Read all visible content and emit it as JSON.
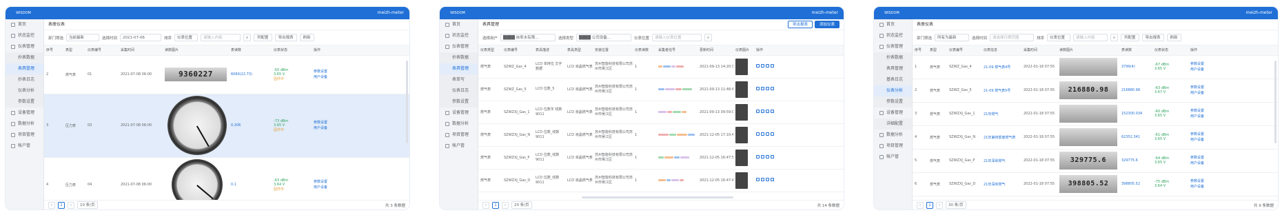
{
  "app": {
    "user": "meizh-meter",
    "logo": "WISDOM WATER"
  },
  "panel1": {
    "title": "表册仪表",
    "sidebar": [
      "首页",
      "状态监控",
      "仪表管理",
      "抄表数据",
      "表具管理",
      "抄表日志",
      "仪表分析",
      "参数设置",
      "设备管理",
      "数据分析",
      "项目管理",
      "帐户管"
    ],
    "filters": {
      "dept_label": "部门筛选",
      "dept_value": "当前最新",
      "time_label": "选择时间",
      "time_value": "2021-07-06",
      "sort_label": "排序",
      "sort_value": "仪表位置",
      "search_ph": "请输入内容",
      "list_btn": "列配置",
      "export_btn": "导出报表",
      "refresh_btn": "刷新"
    },
    "columns": [
      "序号",
      "表型",
      "仪表编号",
      "采集时间",
      "读数图片",
      "表读数",
      "仪表状态",
      "操作"
    ],
    "rows": [
      {
        "no": "2",
        "type": "燃气表",
        "id": "01",
        "time": "2021-07-08 06:00",
        "img_text": "9360227",
        "reading": "6060(22.73)",
        "signal": "-50 dBm",
        "volt": "3.65 V",
        "state": "固件中",
        "op1": "参数设置",
        "op2": "用户设备"
      },
      {
        "no": "3",
        "type": "压力表",
        "id": "03",
        "time": "2021-07-08 06:00",
        "img_text": "",
        "reading": "0.206",
        "signal": "-73 dBm",
        "volt": "3.65 V",
        "state": "固件中",
        "op1": "参数设置",
        "op2": "用户设备"
      },
      {
        "no": "4",
        "type": "压力表",
        "id": "04",
        "time": "2021-07-08 06:00",
        "img_text": "",
        "reading": "0.1",
        "signal": "-63 dBm",
        "volt": "3.64 V",
        "state": "固件中",
        "op1": "参数设置",
        "op2": "用户设备"
      }
    ],
    "footer": {
      "page": "1",
      "size": "10 条/页",
      "total": "共 3 条数据"
    }
  },
  "panel2": {
    "title": "表具管理",
    "btn_a": "导出报表",
    "btn_b": "添加仪表",
    "sidebar": [
      "首页",
      "状态监控",
      "仪表管理",
      "抄表数据",
      "表具管理",
      "表单写",
      "仪表日志",
      "参数设置",
      "设备管理",
      "数据分析",
      "项目管理",
      "帐户管"
    ],
    "filters": {
      "user_label": "选择用户",
      "user_value": "████ 自来水有限...",
      "type_label": "选择类型",
      "type_value": "████ 公司设备...",
      "pos_label": "仪表位置",
      "pos_ph": "请输入仪表位置"
    },
    "columns": [
      "仪表类型",
      "仪表编号",
      "表具描述",
      "表具类型",
      "安装位置",
      "仪表读数",
      "采集者信号",
      "更新时间",
      "仪表图片",
      "操作"
    ],
    "rows": [
      {
        "type": "燃气表",
        "id": "SZWZ_Gas_4",
        "desc": "LCD 单排位 文字数据",
        "kind": "LCD 液晶燃气表",
        "loc": "苏州智能科技有限公司苏州市吴江区",
        "count": "1",
        "time": "2021-09-13 14:20:39"
      },
      {
        "type": "燃气表",
        "id": "SZWZ_Gas_5",
        "desc": "LCD 位数_5",
        "kind": "LCD 液晶燃气表",
        "loc": "苏州智能科技有限公司苏州市吴江区",
        "count": "1",
        "time": "2021-09-13 11:48:44"
      },
      {
        "type": "燃气表",
        "id": "SZWZXJ_Gas_1",
        "desc": "LCD 位数字 线数9011",
        "kind": "LCD 液晶燃气表",
        "loc": "苏州智能科技有限公司苏州市吴江区",
        "count": "1",
        "time": "2021-09-13 09:59:00"
      },
      {
        "type": "燃气表",
        "id": "SZWZXJ_Gas_N",
        "desc": "LCD 位数_线数9011",
        "kind": "LCD 液晶燃气表",
        "loc": "苏州智能科技有限公司苏州市吴江区",
        "count": "1",
        "time": "2021-12-05 17:10:48"
      },
      {
        "type": "燃气表",
        "id": "SZWZXJ_Gas_P",
        "desc": "LCD 位数_线数9011",
        "kind": "LCD 液晶燃气表",
        "loc": "苏州智能科技有限公司苏州市吴江区",
        "count": "1",
        "time": "2021-12-05 16:47:53"
      },
      {
        "type": "燃气表",
        "id": "SZWZXJ_Gas_D",
        "desc": "LCD 位数_线数9011",
        "kind": "LCD 液晶燃气表",
        "loc": "苏州智能科技有限公司苏州市吴江区",
        "count": "1",
        "time": "2021-12-05 16:47:45"
      }
    ],
    "footer": {
      "page": "1",
      "size": "20 条/页",
      "total": "共 14 条数据"
    }
  },
  "panel3": {
    "title": "表册仪表",
    "sidebar": [
      "首页",
      "状态监控",
      "仪表管理",
      "抄表数据",
      "表具管理",
      "基表日志",
      "仪表分析",
      "参数设置",
      "设备管理",
      "详细配置",
      "数据分析",
      "项目管理",
      "帐户管"
    ],
    "filters": {
      "dept_label": "部门筛选",
      "dept_value": "所有为最新",
      "time_label": "选择时间",
      "time_ph": "请选择日期范围",
      "sort_label": "排序",
      "sort_value": "仪表位置",
      "search_ph": "请输入内容",
      "list_btn": "列配置",
      "export_btn": "导出报表",
      "refresh_btn": "刷新"
    },
    "columns": [
      "序号",
      "表型",
      "仪表编号",
      "仪表信息",
      "采集时间",
      "读数图片",
      "表读数",
      "仪表状态",
      "操作"
    ],
    "rows": [
      {
        "no": "1",
        "type": "燃气表",
        "id": "SZWZ_Gas_4",
        "info": "21-09 燃气表4号",
        "time": "2022-01-18 07:55",
        "img_text": "",
        "reading": "3799(4)",
        "signal": "-67 dBm",
        "volt": "3.65 V",
        "op1": "参数设置",
        "op2": "用户设备"
      },
      {
        "no": "2",
        "type": "燃气表",
        "id": "SZWZ_Gas_5",
        "info": "21-09 燃气表5号",
        "time": "2022-01-18 07:55",
        "img_text": "216880.98",
        "reading": "216880.98",
        "signal": "-63 dBm",
        "volt": "3.67 V",
        "op1": "参数设置",
        "op2": "用户设备"
      },
      {
        "no": "3",
        "type": "燃气表",
        "id": "SZWZXJ_Gas_1",
        "info": "21年燃气",
        "time": "2022-01-18 07:55",
        "img_text": "",
        "reading": "152300.034",
        "signal": "-60 dBm",
        "volt": "3.65 V",
        "op1": "参数设置",
        "op2": "用户设备"
      },
      {
        "no": "4",
        "type": "燃气表",
        "id": "SZWZXJ_Gas_N",
        "info": "21年第四季度燃气表",
        "time": "2022-01-18 07:55",
        "img_text": "",
        "reading": "62352.341",
        "signal": "-61 dBm",
        "volt": "3.65 V",
        "op1": "参数设置",
        "op2": "用户设备"
      },
      {
        "no": "5",
        "type": "燃气表",
        "id": "SZWZXJ_Gas_P",
        "info": "21年深圳燃气",
        "time": "2022-01-18 07:55",
        "img_text": "329775.6",
        "reading": "329775.6",
        "signal": "-64 dBm",
        "volt": "3.65 V",
        "op1": "参数设置",
        "op2": "用户设备"
      },
      {
        "no": "6",
        "type": "燃气表",
        "id": "SZWZXJ_Gas_D",
        "info": "21年深圳燃气",
        "time": "2022-01-18 07:55",
        "img_text": "398805.52",
        "reading": "398805.52",
        "signal": "-75 dBm",
        "volt": "3.64 V",
        "op1": "参数设置",
        "op2": "用户设备"
      }
    ],
    "footer": {
      "page": "1",
      "size": "30 条/页",
      "total": "共 9 条数据"
    }
  }
}
